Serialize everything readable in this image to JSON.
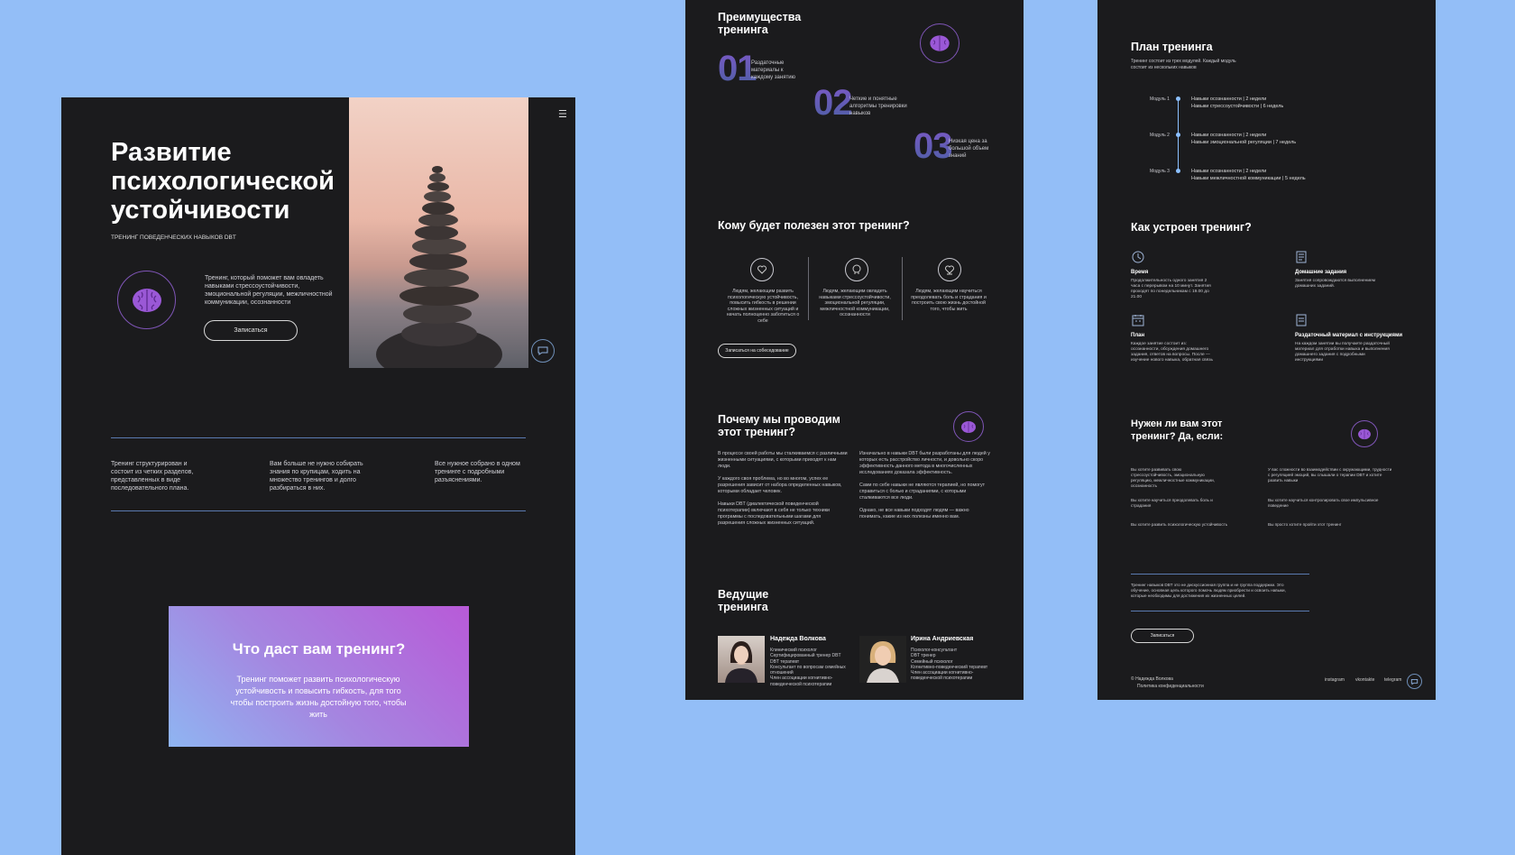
{
  "hero": {
    "title": "Развитие психологической устойчивости",
    "subtitle": "ТРЕНИНГ ПОВЕДЕНЧЕСКИХ НАВЫКОВ DBT",
    "description": "Тренинг, который поможет вам овладеть навыками стрессоустойчивости, эмоциональной регуляции, межличностной коммуникации, осознанности",
    "cta": "Записаться",
    "features": [
      "Тренинг структурирован и состоит из четких разделов, представленных в виде последовательного плана.",
      "Вам больше не нужно собирать знания по крупицам, ходить на множество тренингов и долго разбираться в них.",
      "Все нужное собрано в одном тренинге с подробными разъяснениями."
    ],
    "promo_title": "Что даст вам тренинг?",
    "promo_text": "Тренинг поможет развить психологическую устойчивость и повысить гибкость, для того чтобы построить жизнь достойную того, чтобы жить"
  },
  "advantages": {
    "title": "Преимущества тренинга",
    "items": [
      {
        "num": "01",
        "text": "Раздаточные материалы к каждому занятию"
      },
      {
        "num": "02",
        "text": "Четкие и понятные алгоритмы тренировки навыков"
      },
      {
        "num": "03",
        "text": "Низкая цена за большой объем знаний"
      }
    ]
  },
  "audience": {
    "title": "Кому будет полезен этот тренинг?",
    "items": [
      "Людям, желающим развить психологическую устойчивость, повысить гибкость в решении сложных жизненных ситуаций и начать полноценно заботиться о себе",
      "Людям, желающим овладеть навыками стрессоустойчивости, эмоциональной регуляции, межличностной коммуникации, осознанности",
      "Людям, желающим научиться преодолевать боль и страдания и построить свою жизнь достойной того, чтобы жить"
    ],
    "cta": "Записаться на собеседование"
  },
  "why": {
    "title": "Почему мы проводим этот тренинг?",
    "col1": [
      "В процессе своей работы мы сталкиваемся с различными жизненными ситуациями, с которыми приходят к нам люди.",
      "У каждого своя проблема, но во многом, успех ее разрешения зависит от набора определенных навыков, которыми обладает человек.",
      "Навыки DBT (диалектической поведенческой психотерапии) включают в себя не только техники программы с последовательными шагами для разрешения сложных жизненных ситуаций."
    ],
    "col2": [
      "Изначально в навыки DBT были разработаны для людей у которых есть расстройство личности, и довольно скоро эффективность данного метода в многочисленных исследованиях доказала эффективность.",
      "Сами по себе навыки не являются терапией, но помогут справиться с болью и страданиями, с которыми сталкиваются все люди.",
      "Однако, не все навыки подходят людям — важно понимать, какие из них полезны именно вам."
    ]
  },
  "hosts": {
    "title": "Ведущие тренинга",
    "people": [
      {
        "name": "Надежда Волкова",
        "bullets": [
          "Клинический психолог",
          "Сертифицированный тренер DBT",
          "DBT терапевт",
          "Консультант по вопросам семейных отношений",
          "Член ассоциации когнитивно-поведенческой психотерапии"
        ]
      },
      {
        "name": "Ирина Андриевская",
        "bullets": [
          "Психолог-консультант",
          "DBT тренер",
          "Семейный психолог",
          "Когнитивно-поведенческий терапевт",
          "Член ассоциации когнитивно-поведенческой психотерапии"
        ]
      }
    ]
  },
  "plan": {
    "title": "План тренинга",
    "subtitle": "Тренинг состоит из трех модулей. Каждый модуль состоит из нескольких навыков",
    "modules": [
      {
        "label": "Модуль 1",
        "lines": [
          "Навыки осознанности | 2 недели",
          "Навыки стрессоустойчивости | 6 недель"
        ]
      },
      {
        "label": "Модуль 2",
        "lines": [
          "Навыки осознанности | 2 недели",
          "Навыки эмоциональной регуляции | 7 недель"
        ]
      },
      {
        "label": "Модуль 3",
        "lines": [
          "Навыки осознанности | 2 недели",
          "Навыки межличностной коммуникации | 5 недель"
        ]
      }
    ]
  },
  "structure": {
    "title": "Как устроен тренинг?",
    "items": [
      {
        "icon": "clock-icon",
        "title": "Время",
        "text": "Продолжительность одного занятия 2 часа с перерывом на 10 минут. Занятия проходят по понедельникам с 19.00 до 21.00"
      },
      {
        "icon": "document-icon",
        "title": "Домашние задания",
        "text": "Занятия сопровождаются выполнением домашних заданий."
      },
      {
        "icon": "calendar-icon",
        "title": "План",
        "text": "Каждое занятие состоит из: осознанности, обсуждения домашнего задания, ответов на вопросы. После — изучение нового навыка, обратная связь"
      },
      {
        "icon": "handout-icon",
        "title": "Раздаточный материал с инструкциями",
        "text": "На каждом занятии вы получаете раздаточный материал для отработки навыка и выполнения домашнего задания с подробными инструкциями"
      }
    ]
  },
  "need": {
    "title": "Нужен ли вам этот тренинг? Да, если:",
    "items": [
      "Вы хотите развивать свою стрессоустойчивость, эмоциональную регуляцию, межличностные коммуникации, осознанность",
      "У вас сложности во взаимодействии с окружающими, трудности с регуляцией эмоций, вы слышали о терапии DBT и хотите развить навыки",
      "Вы хотите научиться преодолевать боль и страдания",
      "Вы хотите научиться контролировать свое импульсивное поведение",
      "Вы хотите развить психологическую устойчивость",
      "Вы просто хотите пройти этот тренинг"
    ],
    "note": "Тренинг навыков DBT это не дискуссионная группа и не группа поддержки. Это обучение, основная цель которого помочь людям приобрести и освоить навыки, которые необходимы для достижения их жизненных целей.",
    "cta": "Записаться"
  },
  "footer": {
    "copyright": "© Надежда Волкова",
    "policy": "Политика конфиденциальности",
    "links": [
      "instagram",
      "vkontakte",
      "telegram"
    ]
  },
  "colors": {
    "background": "#93bef7",
    "panel": "#1b1b1d",
    "accent": "#9a58d6",
    "line": "#5a7ab0"
  }
}
